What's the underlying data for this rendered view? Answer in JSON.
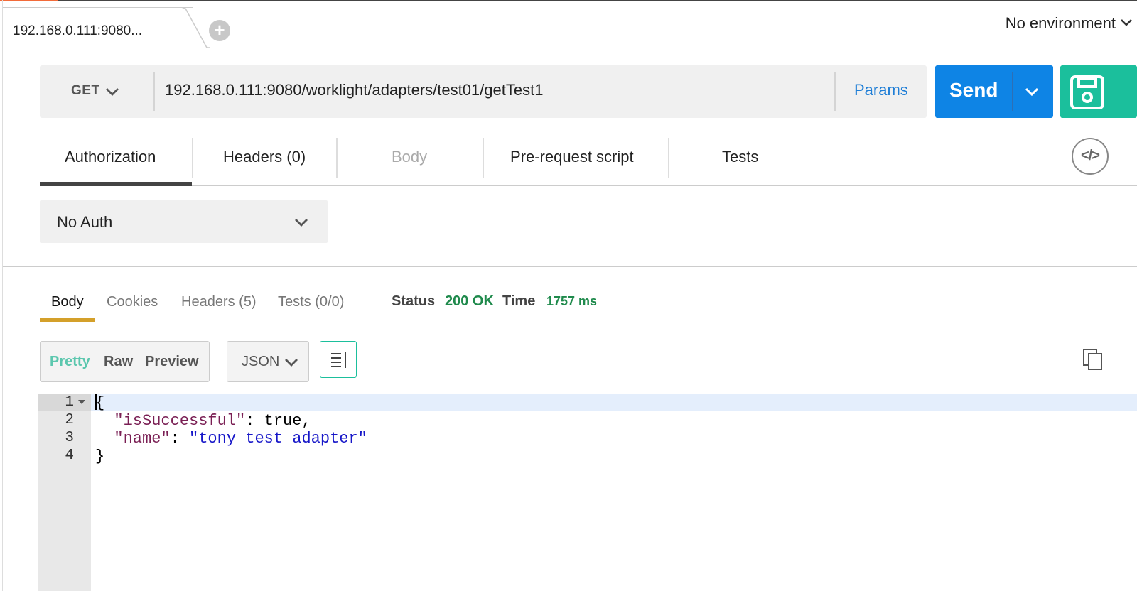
{
  "window": {
    "tab_label": "192.168.0.111:9080...",
    "new_tab_icon": "plus-circle-icon",
    "environment": "No environment"
  },
  "request": {
    "method": "GET",
    "url": "192.168.0.111:9080/worklight/adapters/test01/getTest1",
    "params_label": "Params",
    "send_label": "Send",
    "save_icon": "save-icon",
    "tabs": [
      {
        "label": "Authorization",
        "active": true
      },
      {
        "label": "Headers (0)",
        "active": false
      },
      {
        "label": "Body",
        "active": false,
        "disabled": true
      },
      {
        "label": "Pre-request script",
        "active": false
      },
      {
        "label": "Tests",
        "active": false
      }
    ],
    "code_button": "</>",
    "auth_type": "No Auth"
  },
  "response": {
    "tabs": [
      {
        "label": "Body",
        "active": true
      },
      {
        "label": "Cookies",
        "active": false
      },
      {
        "label": "Headers (5)",
        "active": false
      },
      {
        "label": "Tests (0/0)",
        "active": false
      }
    ],
    "status_label": "Status",
    "status_value": "200 OK",
    "time_label": "Time",
    "time_value": "1757 ms",
    "view_modes": [
      "Pretty",
      "Raw",
      "Preview"
    ],
    "active_view": "Pretty",
    "format": "JSON",
    "line_numbers": [
      "1",
      "2",
      "3",
      "4"
    ],
    "code": {
      "open_brace": "{",
      "key1": "\"isSuccessful\"",
      "val1": "true",
      "key2": "\"name\"",
      "val2": "\"tony test adapter\"",
      "close_brace": "}"
    }
  },
  "colors": {
    "send": "#0e84e5",
    "save": "#1bbf9c",
    "status_ok": "#1f8a4c",
    "response_tab_accent": "#d4a02a",
    "link": "#1f7ed6"
  }
}
